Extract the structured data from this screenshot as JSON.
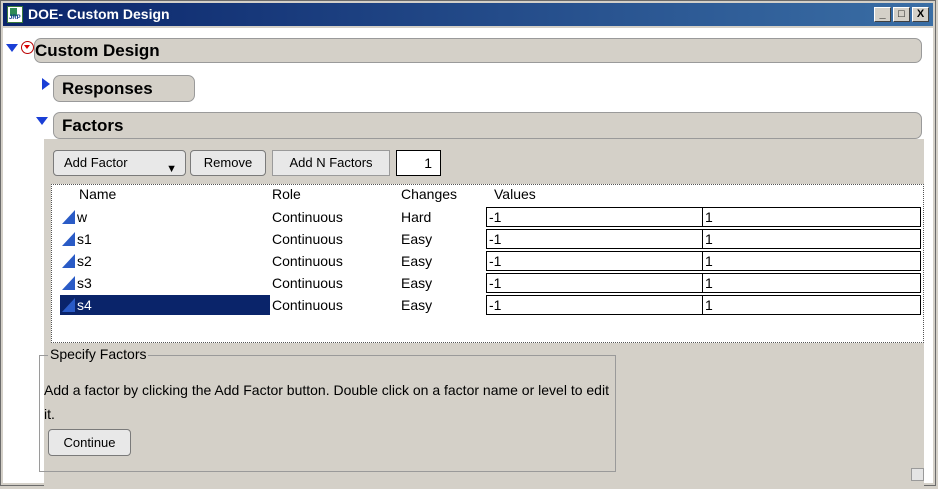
{
  "window": {
    "title": "DOE- Custom Design",
    "minimize_label": "_",
    "maximize_label": "□",
    "close_label": "X",
    "icon_text": "JRP"
  },
  "custom_design": {
    "title": "Custom Design"
  },
  "responses": {
    "title": "Responses"
  },
  "factors": {
    "title": "Factors",
    "add_factor_label": "Add Factor",
    "remove_label": "Remove",
    "add_n_factors_label": "Add N Factors",
    "n_factors_value": "1",
    "columns": {
      "name": "Name",
      "role": "Role",
      "changes": "Changes",
      "values": "Values"
    },
    "rows": [
      {
        "name": "w",
        "role": "Continuous",
        "changes": "Hard",
        "low": "-1",
        "high": "1"
      },
      {
        "name": "s1",
        "role": "Continuous",
        "changes": "Easy",
        "low": "-1",
        "high": "1"
      },
      {
        "name": "s2",
        "role": "Continuous",
        "changes": "Easy",
        "low": "-1",
        "high": "1"
      },
      {
        "name": "s3",
        "role": "Continuous",
        "changes": "Easy",
        "low": "-1",
        "high": "1"
      },
      {
        "name": "s4",
        "role": "Continuous",
        "changes": "Easy",
        "low": "-1",
        "high": "1"
      }
    ],
    "selected_row": "s4"
  },
  "specify_factors": {
    "legend": "Specify Factors",
    "text": "Add a factor by clicking the Add Factor button. Double click on a factor name or level to edit it.",
    "continue_label": "Continue"
  },
  "colors": {
    "titlebar": "#0a246a",
    "disclosure_icon": "#1a3fd6",
    "selection": "#0a246a",
    "panel": "#d4d0c8"
  }
}
